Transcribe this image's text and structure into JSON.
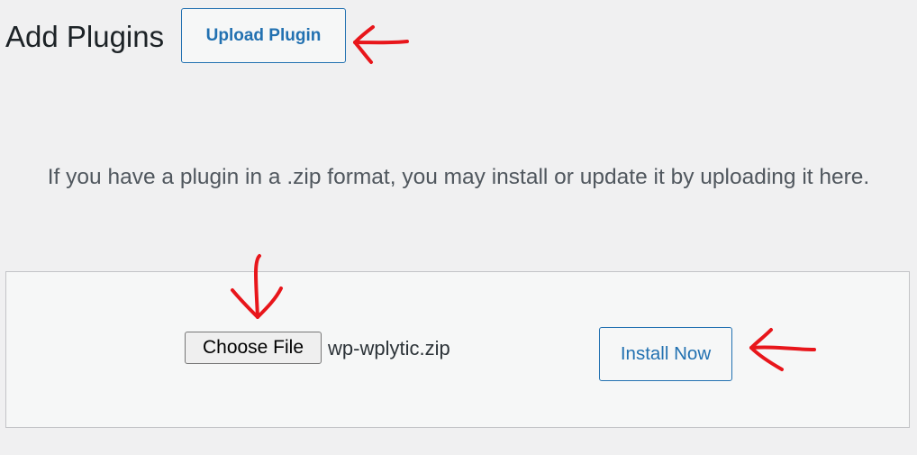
{
  "header": {
    "title": "Add Plugins",
    "upload_button_label": "Upload Plugin"
  },
  "upload_panel": {
    "intro_text": "If you have a plugin in a .zip format, you may install or update it by uploading it here.",
    "choose_file_label": "Choose File",
    "selected_file_name": "wp-wplytic.zip",
    "install_button_label": "Install Now"
  },
  "annotations": {
    "color": "#e8161b",
    "marks": [
      "left-arrow-to-upload-plugin",
      "down-arrow-to-choose-file",
      "left-arrow-to-install-now"
    ]
  },
  "colors": {
    "background": "#f0f0f1",
    "panel_background": "#f6f7f7",
    "accent": "#2271b1",
    "border": "#c3c4c7"
  }
}
